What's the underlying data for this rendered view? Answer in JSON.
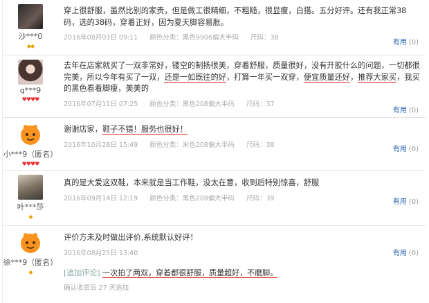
{
  "reviews": [
    {
      "user": "沙***0",
      "avatar_style": "dark-portrait",
      "level_count": 2,
      "level_color": "#e8a400",
      "content": "穿上很舒服，虽然比别的家贵，但是做工很精细，不粗糙，很显瘦，白搭。五分好评。还有我正常38码，选的38码，穿着正好，因为夏天脚容易胀。",
      "date": "2016年08月03日 09:11",
      "category": "颜色分类：黑色9906偏大半码",
      "size": "尺码：38",
      "helpful": "有用",
      "helpful_count": "(0)"
    },
    {
      "user": "q***9",
      "avatar_style": "girl-portrait",
      "level_count": 4,
      "level_color": "#e6322e",
      "content_parts": [
        {
          "text": "去年在店家就买了一双非常好，镂空的制扬很美，穿着舒服，质量很好，没有开胶什么的问题，一切都很完美，所以今年有买了一双，",
          "u": false
        },
        {
          "text": "还是一如既往的好",
          "u": true
        },
        {
          "text": "，打算一年买一双穿，",
          "u": false
        },
        {
          "text": "便宜质量还好",
          "u": true
        },
        {
          "text": "，",
          "u": false
        },
        {
          "text": "推荐大家买",
          "u": true
        },
        {
          "text": "，我买的黑色看着脚瘦，美美的",
          "u": false
        }
      ],
      "date": "2016年07月11日 07:25",
      "category": "颜色分类：黑色208偏大半码",
      "size": "尺码：37",
      "helpful": "有用",
      "helpful_count": "(0)"
    },
    {
      "user": "小***9（匿名）",
      "avatar_style": "orange-mascot",
      "level_count": 4,
      "level_color": "#e6322e",
      "content_plain": "谢谢店家，",
      "content_underlined": "鞋子不错！服务也很好！",
      "date": "2016年10月28日 15:49",
      "category": "颜色分类：米色208偏大半码",
      "size": "尺码：38",
      "helpful": "有用",
      "helpful_count": "(0)"
    },
    {
      "user": "叶***莎",
      "avatar_style": "cat-photo",
      "level_count": 1,
      "level_color": "#e8a400",
      "content": "真的是大爱这双鞋，本来就是当工作鞋，没太在意，收到后特别惊喜，舒服",
      "date": "2016年09月14日 12:19",
      "category": "颜色分类：黑色208偏大半码",
      "size": "尺码：39",
      "helpful": "有用",
      "helpful_count": "(0)"
    },
    {
      "user": "徐***9（匿名）",
      "avatar_style": "orange-mascot",
      "level_count": 1,
      "level_color": "#e8a400",
      "content": "评价方未及时做出评价,系统默认好评！",
      "date": "2016年08月25日 13:40",
      "followup_tag": "[追加评论]",
      "followup_text": "一次拍了两双，穿着都很舒服，质量超好，不磨脚。",
      "followup_since": "确认收货后 27 天追加",
      "helpful": "有用",
      "helpful_count": "(0)"
    }
  ]
}
